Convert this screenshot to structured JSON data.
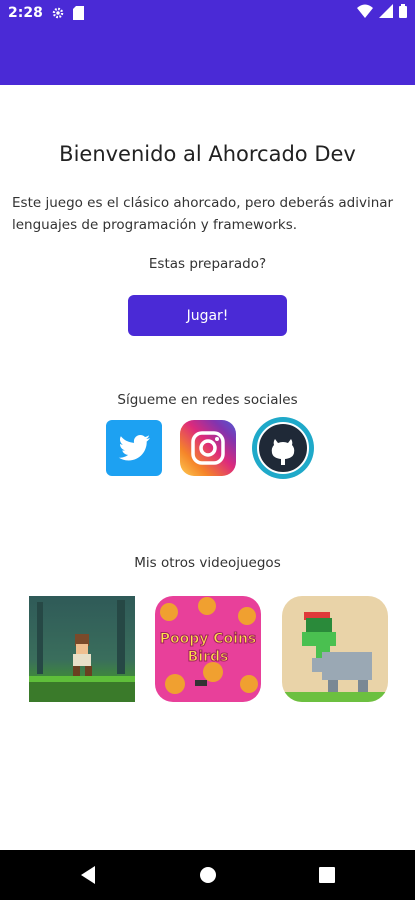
{
  "status": {
    "time": "2:28",
    "icons": [
      "settings-icon",
      "sd-card-icon",
      "wifi-icon",
      "signal-icon",
      "battery-icon"
    ]
  },
  "colors": {
    "primary": "#4a2ad6",
    "twitter": "#1da1f2",
    "github_bg": "#1fa9c9"
  },
  "main": {
    "title": "Bienvenido al Ahorcado Dev",
    "description": "Este juego es el clásico ahorcado, pero deberás adivinar lenguajes de programación y frameworks.",
    "prompt": "Estas preparado?",
    "play_button": "Jugar!"
  },
  "social": {
    "label": "Sígueme en redes sociales",
    "links": [
      "twitter-icon",
      "instagram-icon",
      "github-icon"
    ]
  },
  "games": {
    "label": "Mis otros videojuegos",
    "items": [
      {
        "name": "platformer-game"
      },
      {
        "name": "Poopy Coins Birds",
        "title_line1": "Poopy Coins",
        "title_line2": "Birds"
      },
      {
        "name": "frog-rhino-game"
      }
    ]
  },
  "navbar": {
    "buttons": [
      "back-icon",
      "home-icon",
      "recents-icon"
    ]
  }
}
